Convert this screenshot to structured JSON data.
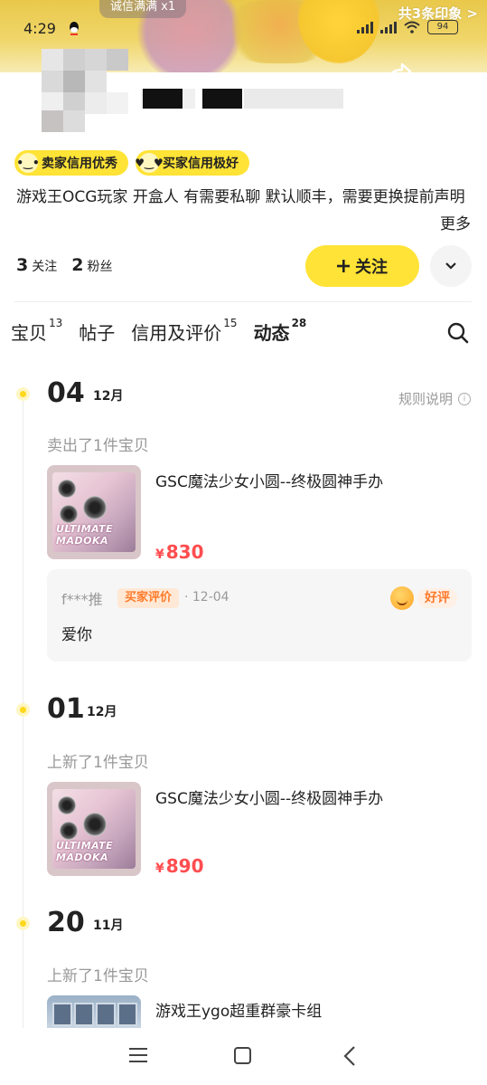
{
  "status_bar": {
    "time": "4:29",
    "battery": "94"
  },
  "banner": {
    "tag": "诚信满满 x1",
    "impressions": "共3条印象 >"
  },
  "profile": {
    "credit_badges": [
      "卖家信用优秀",
      "买家信用极好"
    ],
    "bio": "游戏王OCG玩家 开盒人 有需要私聊 默认顺丰，需要更换提前声明",
    "more_label": "更多",
    "following_count": "3",
    "following_label": "关注",
    "followers_count": "2",
    "followers_label": "粉丝",
    "follow_button": "关注"
  },
  "tabs": [
    {
      "label": "宝贝",
      "count": "13"
    },
    {
      "label": "帖子",
      "count": ""
    },
    {
      "label": "信用及评价",
      "count": "15"
    },
    {
      "label": "动态",
      "count": "28"
    }
  ],
  "feed": {
    "rules_label": "规则说明",
    "entries": [
      {
        "day": "04",
        "month": "12月",
        "action": "卖出了1件宝贝",
        "item_title": "GSC魔法少女小圆--终极圆神手办",
        "currency": "¥",
        "price": "830",
        "review": {
          "user": "f***推",
          "tag": "买家评价",
          "date": "· 12-04",
          "rating": "好评",
          "text": "爱你"
        }
      },
      {
        "day": "01",
        "month": "12月",
        "action": "上新了1件宝贝",
        "item_title": "GSC魔法少女小圆--终极圆神手办",
        "currency": "¥",
        "price": "890"
      },
      {
        "day": "20",
        "month": "11月",
        "action": "上新了1件宝贝",
        "item_title": "游戏王ygo超重群豪卡组"
      }
    ]
  },
  "product_box_logo": "ULTIMATE MADOKA",
  "colors": {
    "accent_yellow": "#ffe336",
    "price_red": "#ff4d4f",
    "review_orange": "#ff7a2a"
  }
}
